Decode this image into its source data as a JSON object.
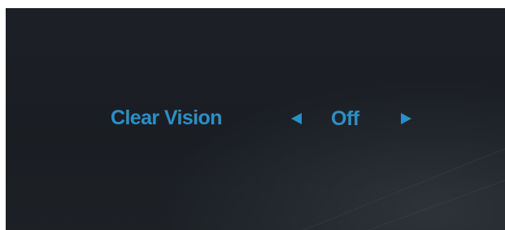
{
  "osd": {
    "setting_label": "Clear Vision",
    "setting_value": "Off",
    "decrease_icon": "triangle-left-icon",
    "increase_icon": "triangle-right-icon"
  },
  "colors": {
    "accent": "#2b8fc6",
    "background": "#1b1f24"
  }
}
